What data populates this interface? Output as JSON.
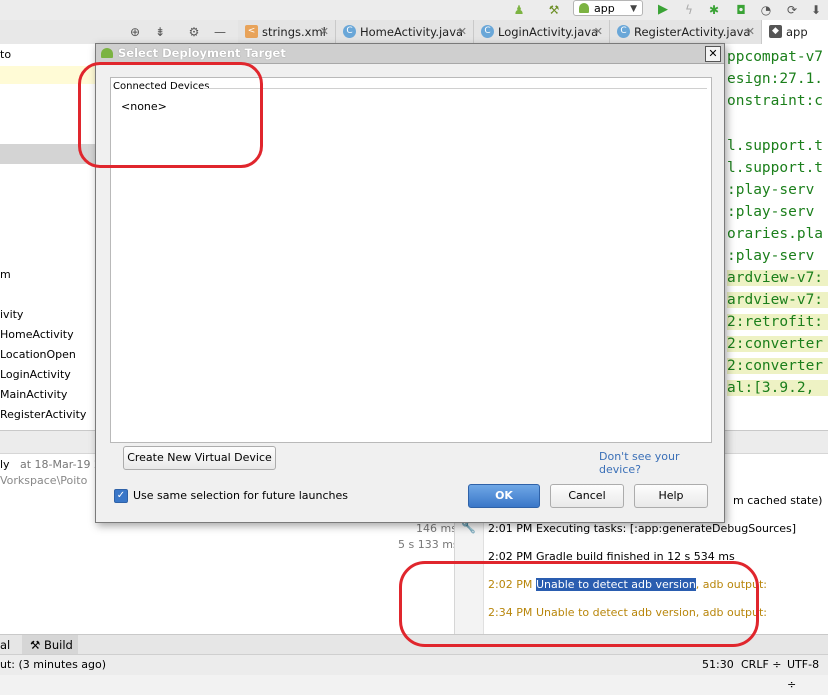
{
  "toolbar": {
    "run_config": "app",
    "icons": [
      "target-icon",
      "collapse-icon",
      "gear-icon",
      "minimize-icon",
      "android-icon",
      "build-hammer-icon",
      "run-icon",
      "apply-changes-icon",
      "debug-icon",
      "coverage-icon",
      "profiler-icon",
      "sync-icon"
    ]
  },
  "tabs": [
    {
      "label": "strings.xml",
      "icon": "xml-icon"
    },
    {
      "label": "HomeActivity.java",
      "icon": "class-icon"
    },
    {
      "label": "LoginActivity.java",
      "icon": "class-icon"
    },
    {
      "label": "RegisterActivity.java",
      "icon": "class-icon"
    },
    {
      "label": "app",
      "icon": "gradle-icon"
    }
  ],
  "left_panel": {
    "items": [
      "to",
      "m",
      "ivity",
      "HomeActivity",
      "LocationOpen",
      "LoginActivity",
      "MainActivity",
      "RegisterActivity"
    ]
  },
  "code_lines": [
    "ppcompat-v7",
    "esign:27.1.",
    "onstraint:c",
    "l.support.t",
    "l.support.t",
    ":play-serv",
    ":play-serv",
    "oraries.pla",
    ":play-serv",
    "ardview-v7:",
    "ardview-v7:",
    "2:retrofit:",
    "2:converter",
    "2:converter",
    "al:[3.9.2,"
  ],
  "bottom_panel": {
    "left_line1": "ly",
    "left_line1_time": "at 18-Mar-19 2",
    "left_line2": "Vorkspace\\Poito",
    "durations": [
      "146 ms",
      "5 s 133 ms"
    ],
    "cached_note": "m cached state)",
    "log": [
      {
        "time": "2:01 PM",
        "pre": "Executing tasks: [:app:generateDebugSources]",
        "sel": "",
        "post": ""
      },
      {
        "time": "2:02 PM",
        "pre": "Gradle build finished in 12 s 534 ms",
        "sel": "",
        "post": ""
      },
      {
        "time": "2:02 PM",
        "pre": "",
        "sel": "Unable to detect adb version",
        "post": ", adb output:"
      },
      {
        "time": "2:34 PM",
        "pre": "Unable to detect adb version, adb output:",
        "sel": "",
        "post": ""
      }
    ]
  },
  "tool_tabs": {
    "terminal": "al",
    "build": "Build"
  },
  "status": {
    "left": "ut: (3 minutes ago)",
    "position": "51:30",
    "line_sep": "CRLF ÷",
    "encoding": "UTF-8 ÷"
  },
  "dialog": {
    "title": "Select Deployment Target",
    "group_label": "Connected Devices",
    "none_item": "<none>",
    "create_button": "Create New Virtual Device",
    "help_link": "Don't see your device?",
    "checkbox_label": "Use same selection for future launches",
    "checkbox_checked": true,
    "ok_button": "OK",
    "cancel_button": "Cancel",
    "help_button": "Help"
  },
  "colors": {
    "annotation": "#e0262d",
    "code_green": "#1b7f1b",
    "warning": "#b8860b",
    "selection": "#2a5db0"
  }
}
